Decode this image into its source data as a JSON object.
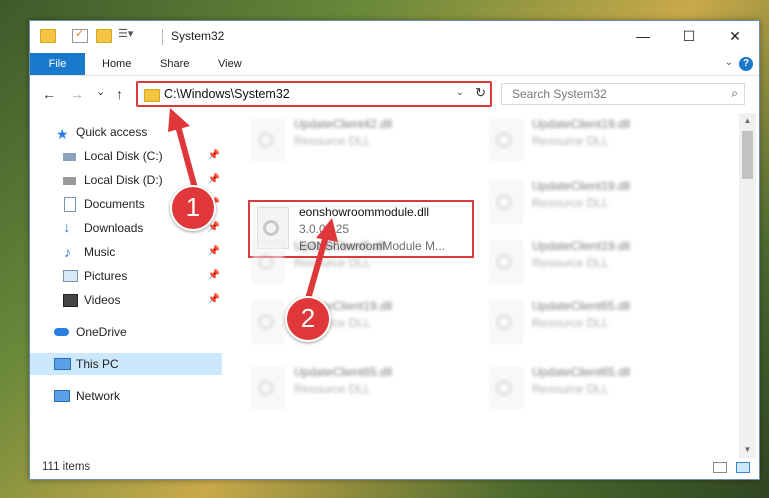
{
  "window": {
    "title": "System32",
    "controls": {
      "minimize": "—",
      "maximize": "☐",
      "close": "✕"
    }
  },
  "ribbon": {
    "tabs": [
      "File",
      "Home",
      "Share",
      "View"
    ],
    "help": "?"
  },
  "nav": {
    "back": "←",
    "forward": "→",
    "recent": "⌄",
    "up": "↑",
    "address": "C:\\Windows\\System32",
    "search_placeholder": "Search System32"
  },
  "sidebar": {
    "items": [
      {
        "label": "Quick access",
        "icon": "star-icon",
        "color": "#2a7de1"
      },
      {
        "label": "Local Disk (C:)",
        "icon": "drive-icon",
        "pinned": true
      },
      {
        "label": "Local Disk (D:)",
        "icon": "drive-icon",
        "pinned": true
      },
      {
        "label": "Documents",
        "icon": "documents-icon",
        "pinned": true
      },
      {
        "label": "Downloads",
        "icon": "downloads-icon",
        "pinned": true
      },
      {
        "label": "Music",
        "icon": "music-icon",
        "pinned": true
      },
      {
        "label": "Pictures",
        "icon": "pictures-icon",
        "pinned": true
      },
      {
        "label": "Videos",
        "icon": "videos-icon",
        "pinned": true
      },
      {
        "label": "OneDrive",
        "icon": "cloud-icon"
      },
      {
        "label": "This PC",
        "icon": "computer-icon",
        "selected": true
      },
      {
        "label": "Network",
        "icon": "network-icon"
      }
    ]
  },
  "files": [
    {
      "name": "UpdateClient42.dll",
      "line2": "Resource DLL",
      "line3": "",
      "blurred": true
    },
    {
      "name": "UpdateClient19.dll",
      "line2": "Resource DLL",
      "line3": "",
      "blurred": true
    },
    {
      "name": "eonshowroommodule.dll",
      "line2": "3.0.0.125",
      "line3": "EONShowroomModule M...",
      "blurred": false
    },
    {
      "name": "UpdateClient19.dll",
      "line2": "Resource DLL",
      "line3": "",
      "blurred": true
    },
    {
      "name": "UpdateClient5.dll",
      "line2": "Resource DLL",
      "line3": "",
      "blurred": true
    },
    {
      "name": "UpdateClient19.dll",
      "line2": "Resource DLL",
      "line3": "",
      "blurred": true
    },
    {
      "name": "UpdateClient19.dll",
      "line2": "Resource DLL",
      "line3": "",
      "blurred": true
    },
    {
      "name": "UpdateClient65.dll",
      "line2": "Resource DLL",
      "line3": "",
      "blurred": true
    },
    {
      "name": "UpdateClient65.dll",
      "line2": "Resource DLL",
      "line3": "",
      "blurred": true
    },
    {
      "name": "UpdateClient65.dll",
      "line2": "Resource DLL",
      "line3": "",
      "blurred": true
    }
  ],
  "status": {
    "items": "111 items"
  },
  "callouts": {
    "step1": "1",
    "step2": "2",
    "color": "#e0383a"
  }
}
